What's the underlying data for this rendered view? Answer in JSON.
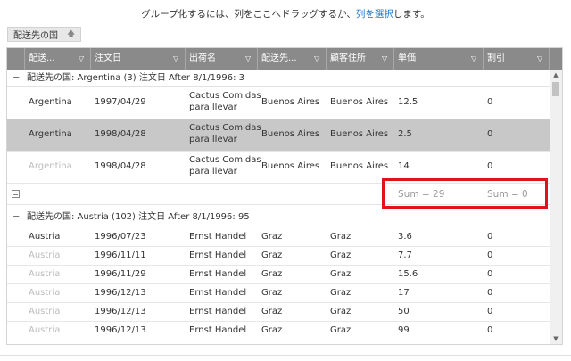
{
  "hint": {
    "pre": "グループ化するには、列をここへドラッグするか、",
    "link": "列を選択",
    "post": "します。"
  },
  "group_chip": {
    "label": "配送先の国",
    "arrow": "🡅"
  },
  "columns": [
    {
      "label": "配送..."
    },
    {
      "label": "注文日"
    },
    {
      "label": "出荷名"
    },
    {
      "label": "配送先..."
    },
    {
      "label": "顧客住所"
    },
    {
      "label": "単価"
    },
    {
      "label": "割引"
    }
  ],
  "groups": [
    {
      "header": "配送先の国: Argentina (3) 注文日  After 8/1/1996: 3",
      "rows": [
        {
          "country": "Argentina",
          "date": "1997/04/29",
          "ship_name": [
            "Cactus Comidas",
            "para llevar"
          ],
          "city": "Buenos Aires",
          "address": "Buenos Aires",
          "price": "12.5",
          "discount": "0",
          "selected": false,
          "faded": false
        },
        {
          "country": "Argentina",
          "date": "1998/04/28",
          "ship_name": [
            "Cactus Comidas",
            "para llevar"
          ],
          "city": "Buenos Aires",
          "address": "Buenos Aires",
          "price": "2.5",
          "discount": "0",
          "selected": true,
          "faded": false
        },
        {
          "country": "Argentina",
          "date": "1998/04/28",
          "ship_name": [
            "Cactus Comidas",
            "para llevar"
          ],
          "city": "Buenos Aires",
          "address": "Buenos Aires",
          "price": "14",
          "discount": "0",
          "selected": false,
          "faded": true
        }
      ],
      "summary": {
        "price": "Sum = 29",
        "discount": "Sum = 0"
      }
    },
    {
      "header": "配送先の国: Austria (102) 注文日  After 8/1/1996: 95",
      "rows": [
        {
          "country": "Austria",
          "date": "1996/07/23",
          "ship_name": [
            "Ernst Handel"
          ],
          "city": "Graz",
          "address": "Graz",
          "price": "3.6",
          "discount": "0",
          "faded": false
        },
        {
          "country": "Austria",
          "date": "1996/11/11",
          "ship_name": [
            "Ernst Handel"
          ],
          "city": "Graz",
          "address": "Graz",
          "price": "7.7",
          "discount": "0",
          "faded": true
        },
        {
          "country": "Austria",
          "date": "1996/11/29",
          "ship_name": [
            "Ernst Handel"
          ],
          "city": "Graz",
          "address": "Graz",
          "price": "15.6",
          "discount": "0",
          "faded": true
        },
        {
          "country": "Austria",
          "date": "1996/12/13",
          "ship_name": [
            "Ernst Handel"
          ],
          "city": "Graz",
          "address": "Graz",
          "price": "17",
          "discount": "0",
          "faded": true
        },
        {
          "country": "Austria",
          "date": "1996/12/13",
          "ship_name": [
            "Ernst Handel"
          ],
          "city": "Graz",
          "address": "Graz",
          "price": "50",
          "discount": "0",
          "faded": true
        },
        {
          "country": "Austria",
          "date": "1996/12/13",
          "ship_name": [
            "Ernst Handel"
          ],
          "city": "Graz",
          "address": "Graz",
          "price": "99",
          "discount": "0",
          "faded": true
        }
      ]
    }
  ],
  "colors": {
    "header_bg": "#8a8a8a",
    "selected_row": "#c8c8c8",
    "highlight_box": "#e0121b",
    "link": "#1a73c4"
  }
}
